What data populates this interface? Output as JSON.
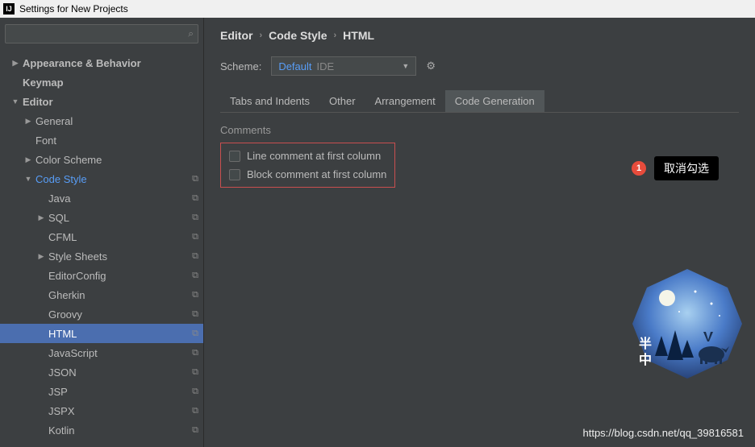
{
  "titlebar": {
    "title": "Settings for New Projects"
  },
  "search": {
    "placeholder": ""
  },
  "sidebar": {
    "items": [
      {
        "label": "Appearance & Behavior",
        "indent": 0,
        "arrow": "▶",
        "bold": true
      },
      {
        "label": "Keymap",
        "indent": 0,
        "bold": true
      },
      {
        "label": "Editor",
        "indent": 0,
        "arrow": "▼",
        "bold": true
      },
      {
        "label": "General",
        "indent": 1,
        "arrow": "▶"
      },
      {
        "label": "Font",
        "indent": 1
      },
      {
        "label": "Color Scheme",
        "indent": 1,
        "arrow": "▶"
      },
      {
        "label": "Code Style",
        "indent": 1,
        "arrow": "▼",
        "highlighted": true,
        "copy": true
      },
      {
        "label": "Java",
        "indent": 2,
        "copy": true
      },
      {
        "label": "SQL",
        "indent": 2,
        "arrow": "▶",
        "copy": true
      },
      {
        "label": "CFML",
        "indent": 2,
        "copy": true
      },
      {
        "label": "Style Sheets",
        "indent": 2,
        "arrow": "▶",
        "copy": true
      },
      {
        "label": "EditorConfig",
        "indent": 2,
        "copy": true
      },
      {
        "label": "Gherkin",
        "indent": 2,
        "copy": true
      },
      {
        "label": "Groovy",
        "indent": 2,
        "copy": true
      },
      {
        "label": "HTML",
        "indent": 2,
        "selected": true,
        "copy": true
      },
      {
        "label": "JavaScript",
        "indent": 2,
        "copy": true
      },
      {
        "label": "JSON",
        "indent": 2,
        "copy": true
      },
      {
        "label": "JSP",
        "indent": 2,
        "copy": true
      },
      {
        "label": "JSPX",
        "indent": 2,
        "copy": true
      },
      {
        "label": "Kotlin",
        "indent": 2,
        "copy": true
      }
    ]
  },
  "breadcrumb": {
    "a": "Editor",
    "b": "Code Style",
    "c": "HTML"
  },
  "scheme": {
    "label": "Scheme:",
    "name": "Default",
    "ide": "IDE"
  },
  "tabs": [
    {
      "label": "Tabs and Indents"
    },
    {
      "label": "Other"
    },
    {
      "label": "Arrangement"
    },
    {
      "label": "Code Generation",
      "active": true
    }
  ],
  "section": {
    "title": "Comments",
    "opt1": "Line comment at first column",
    "opt2": "Block comment at first column"
  },
  "callout": {
    "num": "1",
    "text": "取消勾选"
  },
  "avatar": {
    "text1": "半",
    "text2": "中"
  },
  "watermark": "https://blog.csdn.net/qq_39816581"
}
